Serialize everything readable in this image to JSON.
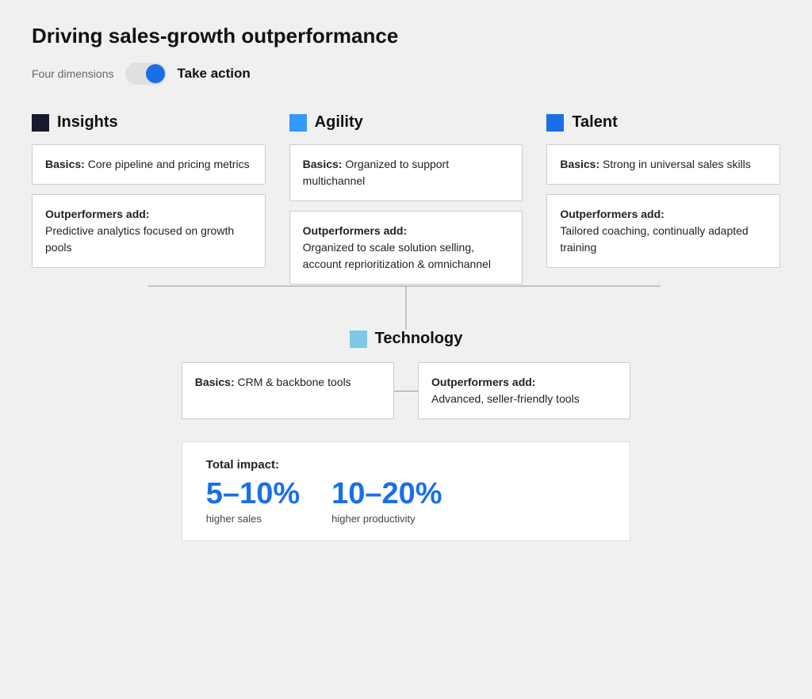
{
  "page": {
    "title": "Driving sales-growth outperformance",
    "toggle": {
      "left_label": "Four dimensions",
      "right_label": "Take action",
      "active": true
    },
    "columns": [
      {
        "id": "insights",
        "icon_type": "dark",
        "title": "Insights",
        "basics_label": "Basics:",
        "basics_text": " Core pipeline and pricing metrics",
        "outperformers_label": "Outperformers add:",
        "outperformers_text": "Predictive analytics focused on growth pools"
      },
      {
        "id": "agility",
        "icon_type": "blue",
        "title": "Agility",
        "basics_label": "Basics:",
        "basics_text": " Organized to support multichannel",
        "outperformers_label": "Outperformers add:",
        "outperformers_text": "Organized to scale solution selling, account reprioritization & omnichannel"
      },
      {
        "id": "talent",
        "icon_type": "navy",
        "title": "Talent",
        "basics_label": "Basics:",
        "basics_text": " Strong in universal sales skills",
        "outperformers_label": "Outperformers add:",
        "outperformers_text": "Tailored coaching, continually adapted training"
      }
    ],
    "technology": {
      "title": "Technology",
      "icon_type": "light_blue",
      "basics_label": "Basics:",
      "basics_text": " CRM & backbone tools",
      "outperformers_label": "Outperformers add:",
      "outperformers_text": "Advanced, seller-friendly tools"
    },
    "total_impact": {
      "label": "Total impact:",
      "items": [
        {
          "number": "5–10%",
          "description": "higher sales"
        },
        {
          "number": "10–20%",
          "description": "higher productivity"
        }
      ]
    }
  }
}
